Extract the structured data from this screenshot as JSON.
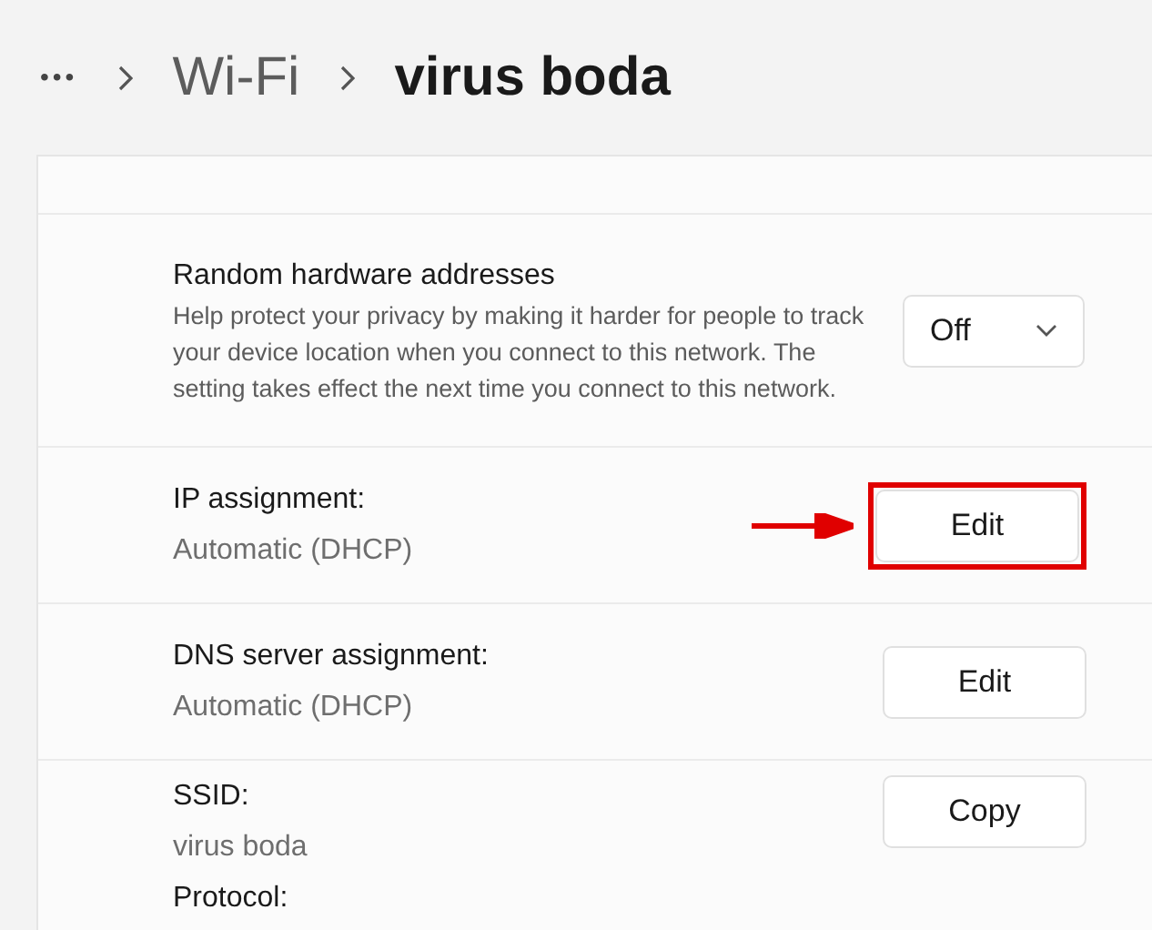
{
  "breadcrumb": {
    "more": "•••",
    "items": [
      {
        "label": "Wi-Fi",
        "selected": false
      },
      {
        "label": "virus boda",
        "selected": true
      }
    ]
  },
  "rows": [
    {
      "kind": "dropdown",
      "title": "Random hardware addresses",
      "description": "Help protect your privacy by making it harder for people to track your device location when you connect to this network. The setting takes effect the next time you connect to this network.",
      "value": "Off"
    },
    {
      "kind": "button",
      "title": "IP assignment:",
      "value": "Automatic (DHCP)",
      "button": "Edit",
      "highlighted": true
    },
    {
      "kind": "button",
      "title": "DNS server assignment:",
      "value": "Automatic (DHCP)",
      "button": "Edit",
      "highlighted": false
    },
    {
      "kind": "button",
      "title": "SSID:",
      "value": "virus boda",
      "button": "Copy",
      "highlighted": false,
      "next_label": "Protocol:"
    }
  ]
}
